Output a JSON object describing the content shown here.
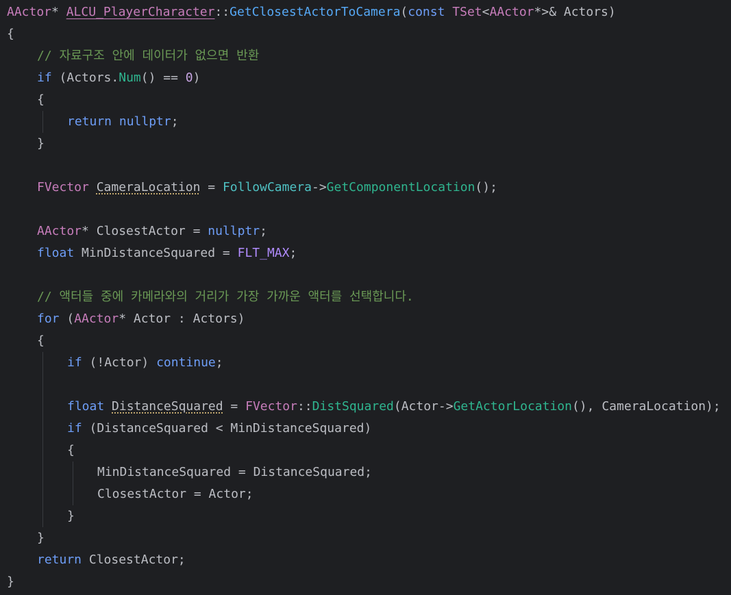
{
  "colors": {
    "background": "#1e1f22",
    "default": "#bcbec4",
    "keyword": "#6e9ef8",
    "type": "#c77dbb",
    "func": "#56a8f5",
    "call": "#2fb58f",
    "member": "#4fc1c3",
    "comment": "#6a9955",
    "number": "#c7a5e2",
    "macro": "#b18cff",
    "guide": "#393b40"
  },
  "lines": [
    {
      "indent": 0,
      "tokens": [
        [
          "AActor",
          "type"
        ],
        [
          "* ",
          "default"
        ],
        [
          "ALCU_PlayerCharacter",
          "type-ul"
        ],
        [
          "::",
          "default"
        ],
        [
          "GetClosestActorToCamera",
          "func"
        ],
        [
          "(",
          "default"
        ],
        [
          "const",
          "keyword"
        ],
        [
          " ",
          "default"
        ],
        [
          "TSet",
          "type"
        ],
        [
          "<",
          "default"
        ],
        [
          "AActor",
          "type"
        ],
        [
          "*>& Actors)",
          "default"
        ]
      ]
    },
    {
      "indent": 0,
      "tokens": [
        [
          "{",
          "default"
        ]
      ]
    },
    {
      "indent": 1,
      "tokens": [
        [
          "// 자료구조 안에 데이터가 없으면 반환",
          "comment"
        ]
      ]
    },
    {
      "indent": 1,
      "tokens": [
        [
          "if",
          "keyword"
        ],
        [
          " (Actors.",
          "default"
        ],
        [
          "Num",
          "call"
        ],
        [
          "() == ",
          "default"
        ],
        [
          "0",
          "number"
        ],
        [
          ")",
          "default"
        ]
      ]
    },
    {
      "indent": 1,
      "tokens": [
        [
          "{",
          "default"
        ]
      ]
    },
    {
      "indent": 2,
      "tokens": [
        [
          "return",
          "keyword"
        ],
        [
          " ",
          "default"
        ],
        [
          "nullptr",
          "keyword"
        ],
        [
          ";",
          "default"
        ]
      ]
    },
    {
      "indent": 1,
      "tokens": [
        [
          "}",
          "default"
        ]
      ]
    },
    {
      "indent": 0,
      "tokens": []
    },
    {
      "indent": 1,
      "tokens": [
        [
          "FVector",
          "type"
        ],
        [
          " ",
          "default"
        ],
        [
          "CameraLocation",
          "default-dotted"
        ],
        [
          " = ",
          "default"
        ],
        [
          "FollowCamera",
          "member"
        ],
        [
          "->",
          "default"
        ],
        [
          "GetComponentLocation",
          "call"
        ],
        [
          "();",
          "default"
        ]
      ]
    },
    {
      "indent": 0,
      "tokens": []
    },
    {
      "indent": 1,
      "tokens": [
        [
          "AActor",
          "type"
        ],
        [
          "* ClosestActor = ",
          "default"
        ],
        [
          "nullptr",
          "keyword"
        ],
        [
          ";",
          "default"
        ]
      ]
    },
    {
      "indent": 1,
      "tokens": [
        [
          "float",
          "keyword"
        ],
        [
          " MinDistanceSquared = ",
          "default"
        ],
        [
          "FLT_MAX",
          "macro"
        ],
        [
          ";",
          "default"
        ]
      ]
    },
    {
      "indent": 0,
      "tokens": []
    },
    {
      "indent": 1,
      "tokens": [
        [
          "// 액터들 중에 카메라와의 거리가 가장 가까운 액터를 선택합니다.",
          "comment"
        ]
      ]
    },
    {
      "indent": 1,
      "tokens": [
        [
          "for",
          "keyword"
        ],
        [
          " (",
          "default"
        ],
        [
          "AActor",
          "type"
        ],
        [
          "* Actor : Actors)",
          "default"
        ]
      ]
    },
    {
      "indent": 1,
      "tokens": [
        [
          "{",
          "default"
        ]
      ]
    },
    {
      "indent": 2,
      "tokens": [
        [
          "if",
          "keyword"
        ],
        [
          " (!Actor) ",
          "default"
        ],
        [
          "continue",
          "keyword"
        ],
        [
          ";",
          "default"
        ]
      ]
    },
    {
      "indent": 0,
      "tokens": []
    },
    {
      "indent": 2,
      "tokens": [
        [
          "float",
          "keyword"
        ],
        [
          " ",
          "default"
        ],
        [
          "DistanceSquared",
          "default-dotted"
        ],
        [
          " = ",
          "default"
        ],
        [
          "FVector",
          "type"
        ],
        [
          "::",
          "default"
        ],
        [
          "DistSquared",
          "call"
        ],
        [
          "(Actor->",
          "default"
        ],
        [
          "GetActorLocation",
          "call"
        ],
        [
          "(), CameraLocation);",
          "default"
        ]
      ]
    },
    {
      "indent": 2,
      "tokens": [
        [
          "if",
          "keyword"
        ],
        [
          " (DistanceSquared < MinDistanceSquared)",
          "default"
        ]
      ]
    },
    {
      "indent": 2,
      "tokens": [
        [
          "{",
          "default"
        ]
      ]
    },
    {
      "indent": 3,
      "tokens": [
        [
          "MinDistanceSquared = DistanceSquared;",
          "default"
        ]
      ]
    },
    {
      "indent": 3,
      "tokens": [
        [
          "ClosestActor = Actor;",
          "default"
        ]
      ]
    },
    {
      "indent": 2,
      "tokens": [
        [
          "}",
          "default"
        ]
      ]
    },
    {
      "indent": 1,
      "tokens": [
        [
          "}",
          "default"
        ]
      ]
    },
    {
      "indent": 1,
      "tokens": [
        [
          "return",
          "keyword"
        ],
        [
          " ClosestActor;",
          "default"
        ]
      ]
    },
    {
      "indent": 0,
      "tokens": [
        [
          "}",
          "default"
        ]
      ]
    }
  ]
}
